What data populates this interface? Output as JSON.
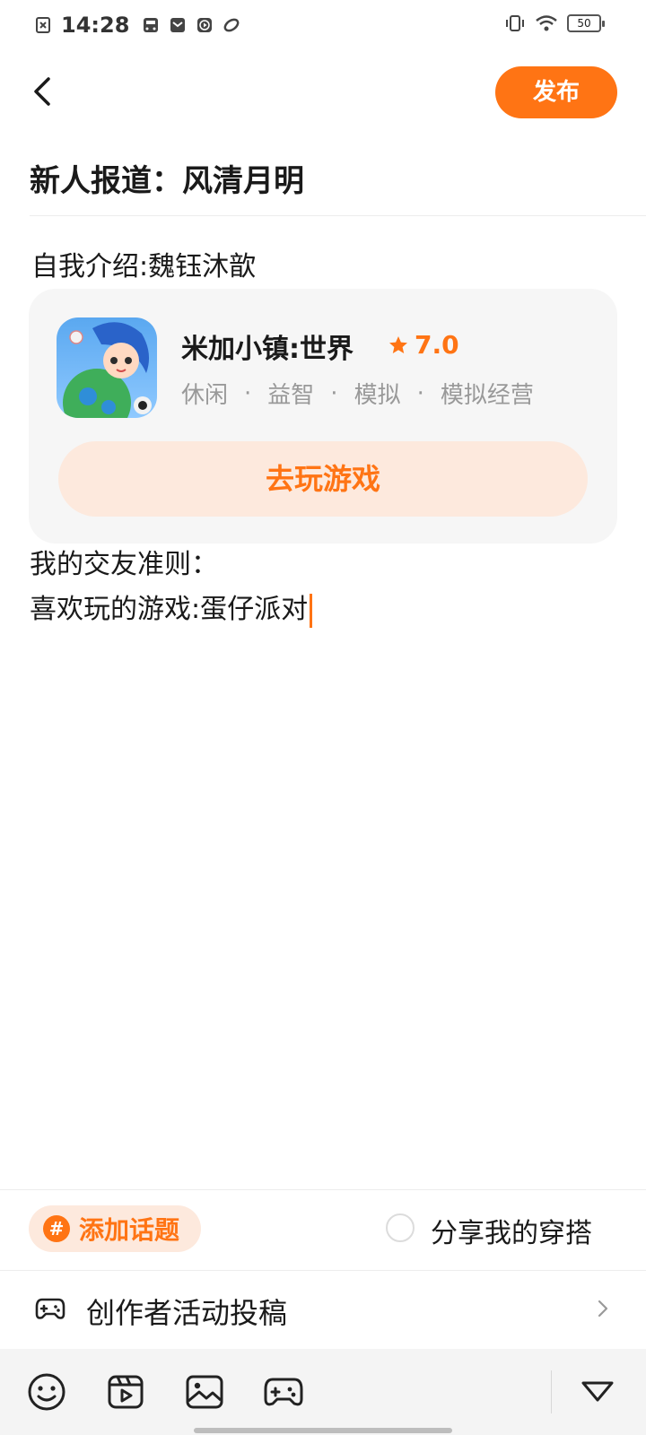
{
  "status_bar": {
    "time": "14:28",
    "battery": "50",
    "left_icons": [
      "close-notify-icon",
      "bus-icon",
      "mail-icon",
      "play-icon",
      "swirl-icon"
    ],
    "right_icons": [
      "vibrate-icon",
      "wifi-icon",
      "battery-icon"
    ]
  },
  "header": {
    "back_icon": "chevron-left-icon",
    "publish_label": "发布"
  },
  "post": {
    "title": "新人报道：风清月明",
    "intro": "自我介绍:魏钰沐歆",
    "line1": "我的交友准则：",
    "line2": "喜欢玩的游戏:蛋仔派对"
  },
  "game_card": {
    "name": "米加小镇:世界",
    "rating": "7.0",
    "tags": [
      "休闲",
      "益智",
      "模拟",
      "模拟经营"
    ],
    "play_label": "去玩游戏"
  },
  "bottom": {
    "topic_label": "添加话题",
    "share_label": "分享我的穿搭",
    "activity_label": "创作者活动投稿"
  },
  "toolbar": {
    "icons": [
      "emoji-icon",
      "video-icon",
      "image-icon",
      "gamepad-icon",
      "collapse-triangle-icon"
    ]
  },
  "colors": {
    "accent": "#ff7414",
    "accent_light": "#fde9dd",
    "card_bg": "#f6f6f6",
    "tag_text": "#999999"
  }
}
